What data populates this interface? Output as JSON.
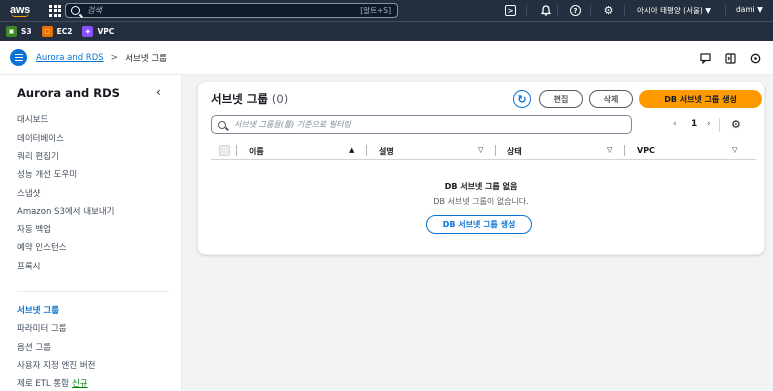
{
  "topbar": {
    "logo": "aws",
    "search_placeholder": "검색",
    "search_shortcut": "[알트+S]",
    "region": "아시아 태평양 (서울) ▼",
    "user": "dami ▼"
  },
  "favorites": [
    {
      "label": "S3",
      "color": "#3f8624"
    },
    {
      "label": "EC2",
      "color": "#ed7100"
    },
    {
      "label": "VPC",
      "color": "#8c4fff"
    }
  ],
  "breadcrumb": {
    "parent": "Aurora and RDS",
    "separator": ">",
    "current": "서브넷 그룹"
  },
  "sidebar": {
    "title": "Aurora and RDS",
    "close_glyph": "‹",
    "items": [
      {
        "label": "대시보드"
      },
      {
        "label": "데이터베이스"
      },
      {
        "label": "쿼리 편집기"
      },
      {
        "label": "성능 개선 도우미"
      },
      {
        "label": "스냅샷"
      },
      {
        "label": "Amazon S3에서 내보내기"
      },
      {
        "label": "자동 백업"
      },
      {
        "label": "예약 인스턴스"
      },
      {
        "label": "프록시"
      }
    ],
    "items2": [
      {
        "label": "서브넷 그룹",
        "active": true
      },
      {
        "label": "파라미터 그룹"
      },
      {
        "label": "옵션 그룹"
      },
      {
        "label": "사용자 지정 엔진 버전"
      },
      {
        "label": "제로 ETL 통합",
        "tag": "신규"
      }
    ]
  },
  "card": {
    "title": "서브넷 그룹",
    "count": "(0)",
    "edit_label": "편집",
    "delete_label": "삭제",
    "create_label": "DB 서브넷 그룹 생성",
    "filter_placeholder": "서브넷 그룹을(를) 기준으로 필터링",
    "pager": {
      "prev": "‹",
      "page": "1",
      "next": "›"
    },
    "columns": [
      "이름",
      "설명",
      "상태",
      "VPC"
    ],
    "empty_title": "DB 서브넷 그룹 없음",
    "empty_desc": "DB 서브넷 그룹이 없습니다.",
    "empty_button": "DB 서브넷 그룹 생성"
  }
}
